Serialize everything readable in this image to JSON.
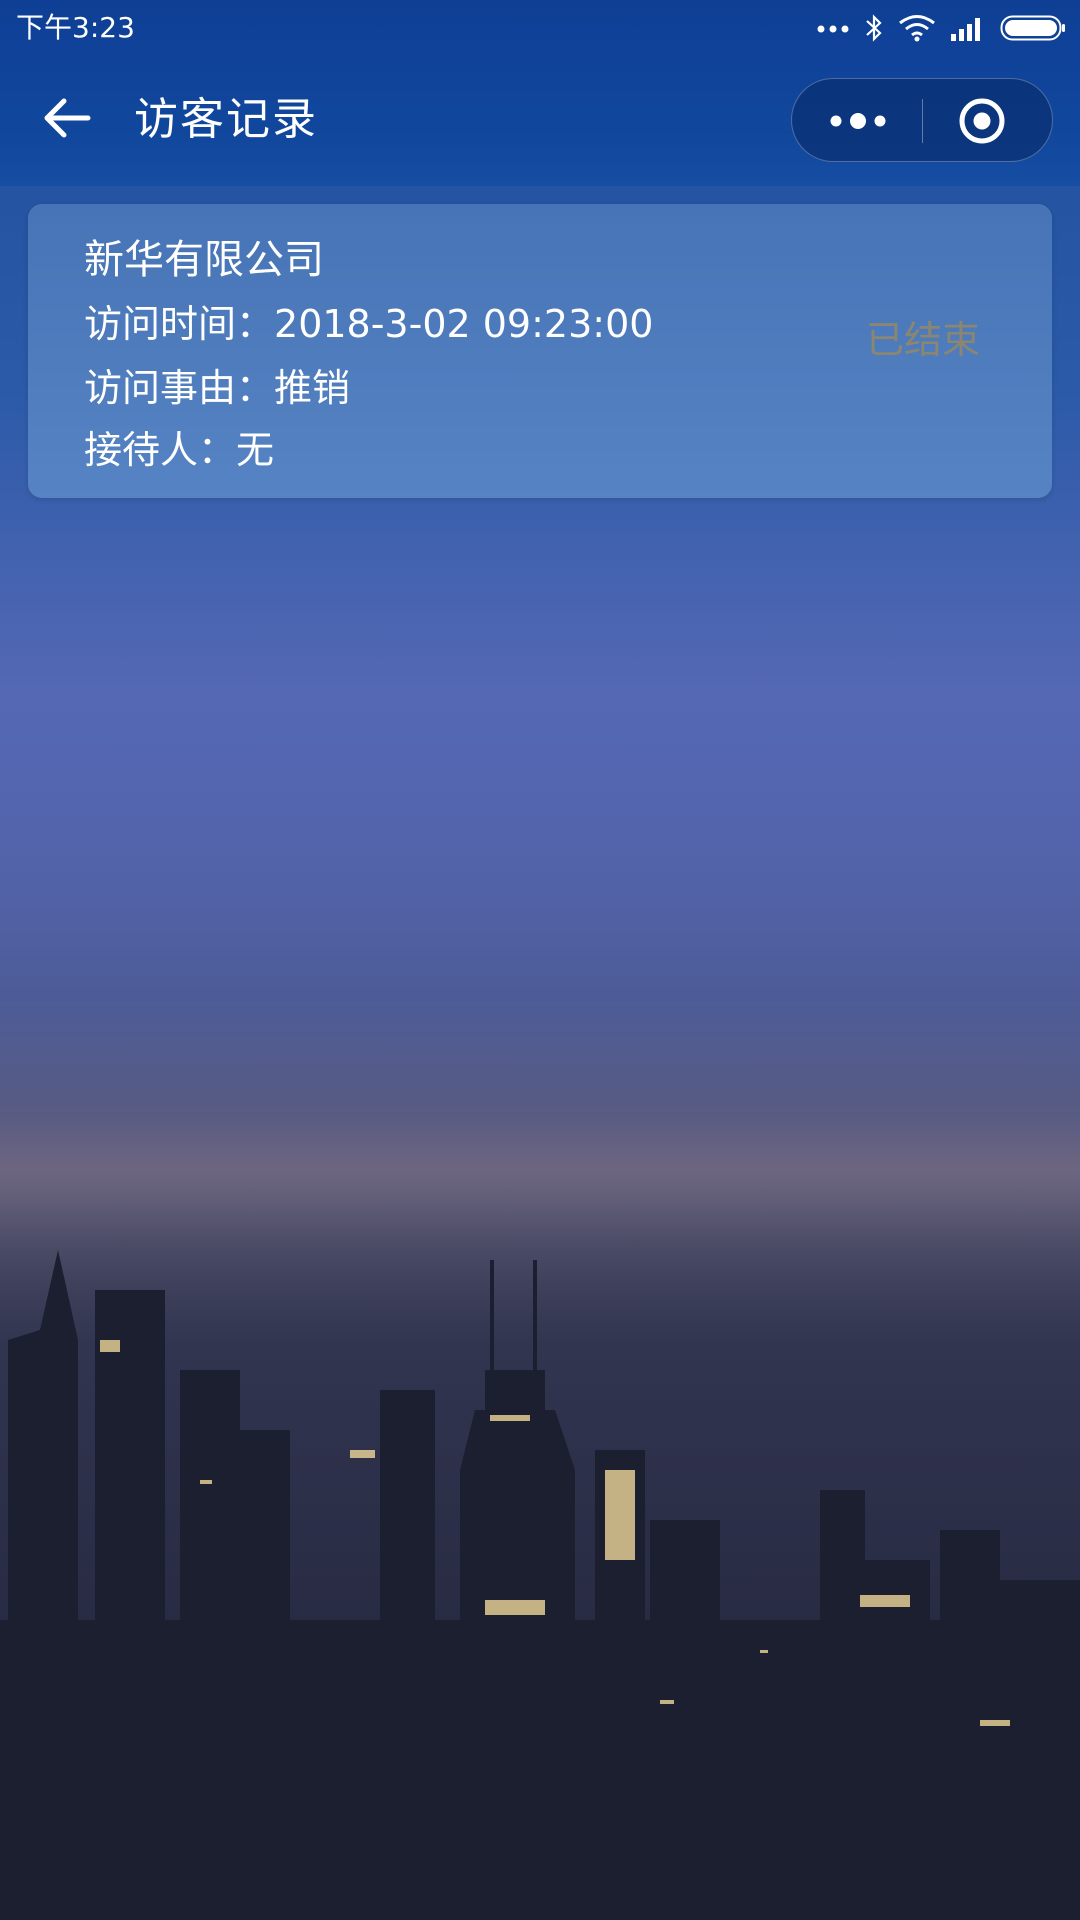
{
  "status_bar": {
    "time": "下午3:23"
  },
  "nav": {
    "title": "访客记录"
  },
  "records": [
    {
      "company": "新华有限公司",
      "visit_time_label": "访问时间：",
      "visit_time": "2018-3-02 09:23:00",
      "reason_label": "访问事由：",
      "reason": "推销",
      "receptionist_label": "接待人：",
      "receptionist": "无",
      "status": "已结束"
    }
  ],
  "colors": {
    "header": "#10479d",
    "card": "#4f7dbd",
    "status_text": "#8b8670"
  }
}
